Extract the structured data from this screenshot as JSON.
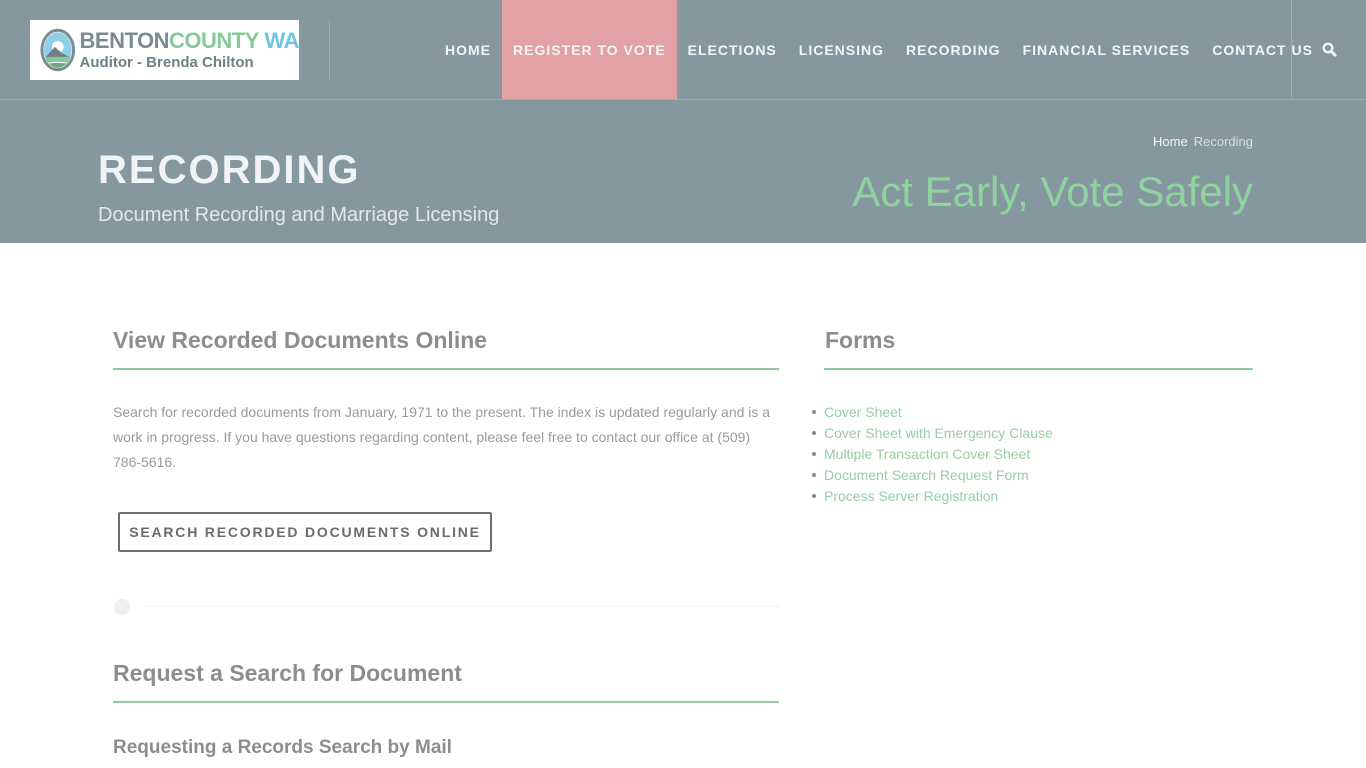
{
  "header": {
    "logo": {
      "line1_part1": "BENTON",
      "line1_part2": "COUNTY",
      "line1_part3": "WA",
      "line2": "Auditor - Brenda Chilton"
    },
    "nav": [
      {
        "label": "HOME",
        "active": false
      },
      {
        "label": "REGISTER TO VOTE",
        "active": true
      },
      {
        "label": "ELECTIONS",
        "active": false
      },
      {
        "label": "LICENSING",
        "active": false
      },
      {
        "label": "RECORDING",
        "active": false
      },
      {
        "label": "FINANCIAL SERVICES",
        "active": false
      },
      {
        "label": "CONTACT US",
        "active": false
      }
    ],
    "search_icon": "search-icon"
  },
  "banner": {
    "title": "RECORDING",
    "subtitle": "Document Recording and Marriage Licensing",
    "breadcrumb": {
      "home": "Home",
      "current": "Recording"
    },
    "slogan": "Act Early, Vote Safely"
  },
  "main": {
    "view_section": {
      "heading": "View Recorded Documents Online",
      "body": "Search for recorded documents from January, 1971 to the present. The index is updated regularly and is a work in progress. If you have questions regarding content, please feel free to contact our office at (509) 786-5616.",
      "button_label": "SEARCH RECORDED DOCUMENTS ONLINE"
    },
    "request_section": {
      "heading": "Request a Search for Document",
      "subheading": "Requesting a Records Search by Mail"
    },
    "forms_section": {
      "heading": "Forms",
      "items": [
        "Cover Sheet",
        "Cover Sheet with Emergency Clause",
        "Multiple Transaction Cover Sheet",
        "Document Search Request Form",
        "Process Server Registration"
      ]
    }
  },
  "colors": {
    "header_bg": "#86989f",
    "active_nav_bg": "#e2a2a3",
    "accent_green": "#93c9a3",
    "slogan_green": "#8fd39f",
    "heading_gray": "#8d8d8d"
  }
}
